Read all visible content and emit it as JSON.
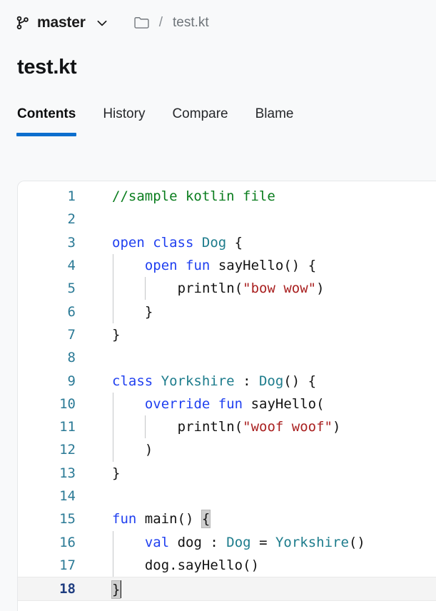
{
  "theme": {
    "accent": "#0d6fce",
    "page_bg": "#f8f9fa",
    "panel_bg": "#ffffff",
    "line_number_color": "#2b7a96",
    "active_line_number_color": "#1f3d80",
    "comment_color": "#0a7d1e",
    "keyword_color": "#2040f0",
    "type_color": "#1d7c8c",
    "string_color": "#a92020"
  },
  "breadcrumb": {
    "branch_icon": "git-branch-icon",
    "branch_name": "master",
    "chevron_icon": "chevron-down-icon",
    "folder_icon": "folder-icon",
    "separator": "/",
    "file_name": "test.kt"
  },
  "header": {
    "title": "test.kt"
  },
  "tabs": [
    {
      "label": "Contents",
      "active": true
    },
    {
      "label": "History",
      "active": false
    },
    {
      "label": "Compare",
      "active": false
    },
    {
      "label": "Blame",
      "active": false
    }
  ],
  "editor": {
    "language": "kotlin",
    "current_line": 18,
    "caret_line": 18,
    "total_lines": 18,
    "lines": [
      {
        "n": "1",
        "text": "//sample kotlin file"
      },
      {
        "n": "2",
        "text": ""
      },
      {
        "n": "3",
        "text": "open class Dog {"
      },
      {
        "n": "4",
        "text": "    open fun sayHello() {"
      },
      {
        "n": "5",
        "text": "        println(\"bow wow\")"
      },
      {
        "n": "6",
        "text": "    }"
      },
      {
        "n": "7",
        "text": "}"
      },
      {
        "n": "8",
        "text": ""
      },
      {
        "n": "9",
        "text": "class Yorkshire : Dog() {"
      },
      {
        "n": "10",
        "text": "    override fun sayHello("
      },
      {
        "n": "11",
        "text": "        println(\"woof woof\")"
      },
      {
        "n": "12",
        "text": "    )"
      },
      {
        "n": "13",
        "text": "}"
      },
      {
        "n": "14",
        "text": ""
      },
      {
        "n": "15",
        "text": "fun main() {"
      },
      {
        "n": "16",
        "text": "    val dog : Dog = Yorkshire()"
      },
      {
        "n": "17",
        "text": "    dog.sayHello()"
      },
      {
        "n": "18",
        "text": "}"
      }
    ]
  }
}
